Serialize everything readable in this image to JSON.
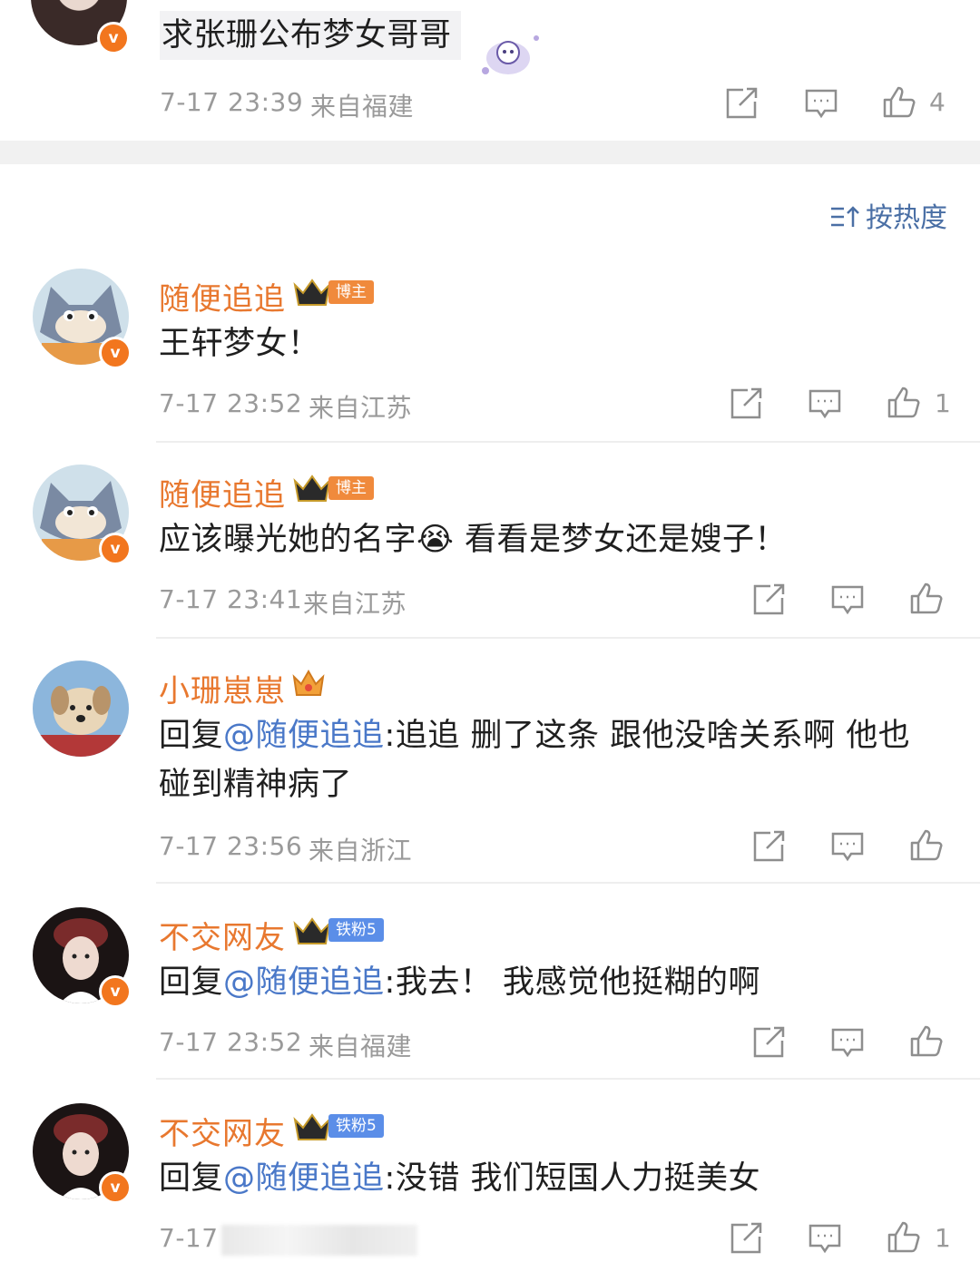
{
  "header_comment": {
    "text": "求张珊公布梦女哥哥",
    "time": "7-17 23:39",
    "location": "来自福建",
    "likes": "4"
  },
  "sort": {
    "label": "按热度",
    "icon": "sort-icon"
  },
  "comments": [
    {
      "user": "随便追追",
      "tag": "博主",
      "text": "王轩梦女！",
      "time": "7-17 23:52",
      "location": "来自江苏",
      "likes": "1"
    },
    {
      "user": "随便追追",
      "tag": "博主",
      "text_before": "应该曝光她的名字",
      "emoji": "😭",
      "text_after": " 看看是梦女还是嫂子！",
      "time": "7-17 23:41",
      "location": "来自江苏",
      "likes": ""
    },
    {
      "user": "小珊崽崽",
      "tag": "",
      "reply_prefix": "回复",
      "mention": "@随便追追",
      "text_line1": ":追追 删了这条 跟他没啥关系啊 他也",
      "text_line2": "碰到精神病了",
      "time": "7-17 23:56",
      "location": "来自浙江",
      "likes": ""
    },
    {
      "user": "不交网友",
      "tag": "铁粉5",
      "reply_prefix": "回复",
      "mention": "@随便追追",
      "text": ":我去！ 我感觉他挺糊的啊",
      "time": "7-17 23:52",
      "location": "来自福建",
      "likes": ""
    },
    {
      "user": "不交网友",
      "tag": "铁粉5",
      "reply_prefix": "回复",
      "mention": "@随便追追",
      "text": ":没错 我们短国人力挺美女",
      "time": "7-17",
      "location": "",
      "likes": "1"
    }
  ],
  "colors": {
    "username": "#e8782f",
    "mention": "#4a78c8",
    "meta": "#9a9a9a",
    "vbadge": "#f2761e"
  }
}
